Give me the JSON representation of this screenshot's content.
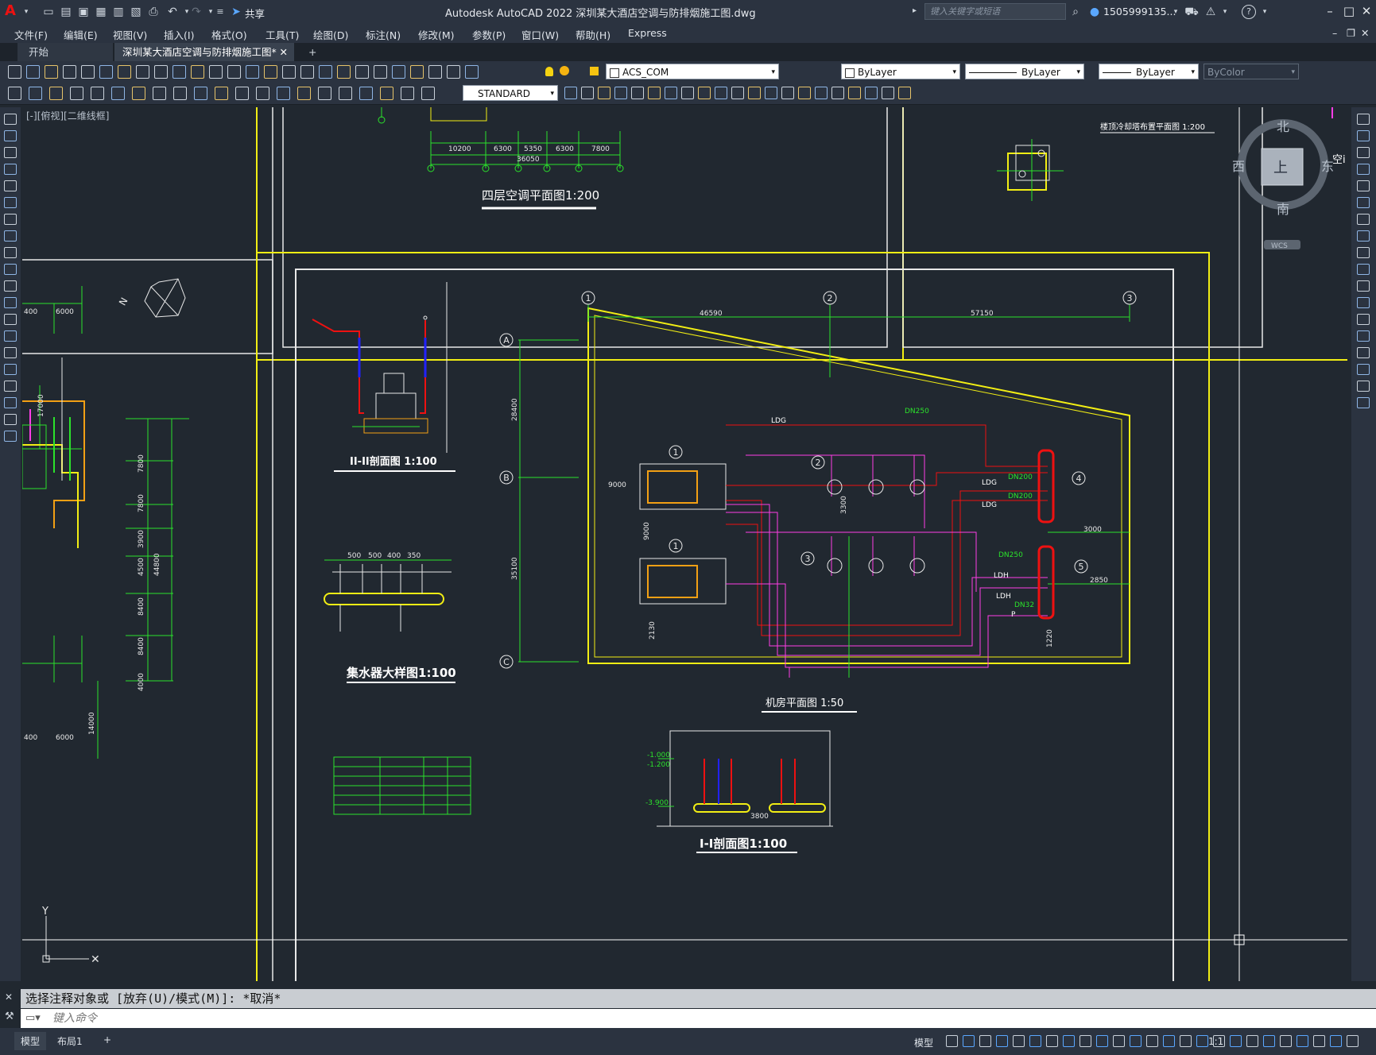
{
  "app": {
    "title": "Autodesk AutoCAD 2022    深圳某大酒店空调与防排烟施工图.dwg",
    "share_label": "共享",
    "search_placeholder": "键入关键字或短语",
    "user": "1505999135...",
    "help": "?"
  },
  "menu": [
    "文件(F)",
    "编辑(E)",
    "视图(V)",
    "插入(I)",
    "格式(O)",
    "工具(T)",
    "绘图(D)",
    "标注(N)",
    "修改(M)",
    "参数(P)",
    "窗口(W)",
    "帮助(H)",
    "Express"
  ],
  "tabs": {
    "start": "开始",
    "active": "深圳某大酒店空调与防排烟施工图*",
    "close": "✕",
    "add": "+"
  },
  "toolbar": {
    "layer": "ACS_COM",
    "color": "ByLayer",
    "linetype": "ByLayer",
    "lineweight": "ByLayer",
    "plotstyle": "ByColor",
    "textstyle": "STANDARD"
  },
  "viewport_label": "[-][俯视][二维线框]",
  "viewcube": {
    "north": "北",
    "south": "南",
    "east": "东",
    "west": "西",
    "top": "上",
    "wcs": "WCS"
  },
  "drawing": {
    "fourth_floor_title": "四层空调平面图1:200",
    "roof_title": "楼顶冷却塔布置平面图 1:200",
    "section2_title": "II-II剖面图 1:100",
    "header_title": "集水器大样图1:100",
    "machine_room_title": "机房平面图 1:50",
    "section1_title": "I-I剖面图1:100",
    "dims_top": [
      "10200",
      "6300",
      "5350",
      "6300",
      "7800"
    ],
    "dim_total": "36050",
    "axis_numbers": [
      "1",
      "2",
      "3"
    ],
    "axis_letters": [
      "A",
      "B",
      "C"
    ],
    "dim_axis12": "46590",
    "dim_axis23": "57150",
    "dim_AB": "28400",
    "dim_BC": "35100",
    "pipes": [
      "LDG",
      "DN250",
      "LDG",
      "LDG",
      "DN200",
      "DN200",
      "DN250",
      "LDH",
      "LDH",
      "DN32",
      "P"
    ],
    "dims_room": [
      "9000",
      "9000",
      "2130",
      "3300",
      "3000",
      "2850",
      "1220"
    ],
    "equipment_tags": [
      "1",
      "1",
      "2",
      "3",
      "4",
      "5"
    ],
    "left_dims": [
      "7800",
      "7800",
      "3900",
      "4500",
      "8400",
      "8400",
      "4000",
      "44800",
      "6000",
      "14000",
      "6000",
      "17000",
      "400",
      "400"
    ],
    "header_dims": [
      "500",
      "500",
      "400",
      "350"
    ],
    "section1_dims": [
      "-1.000",
      "-1.200",
      "-3.900",
      "3800"
    ]
  },
  "command": {
    "history": "选择注释对象或 [放弃(U)/模式(M)]: *取消*",
    "placeholder": "键入命令"
  },
  "status": {
    "model_tab": "模型",
    "layout_tab": "布局1",
    "add": "+",
    "model_label": "模型",
    "scale": "1:1"
  }
}
